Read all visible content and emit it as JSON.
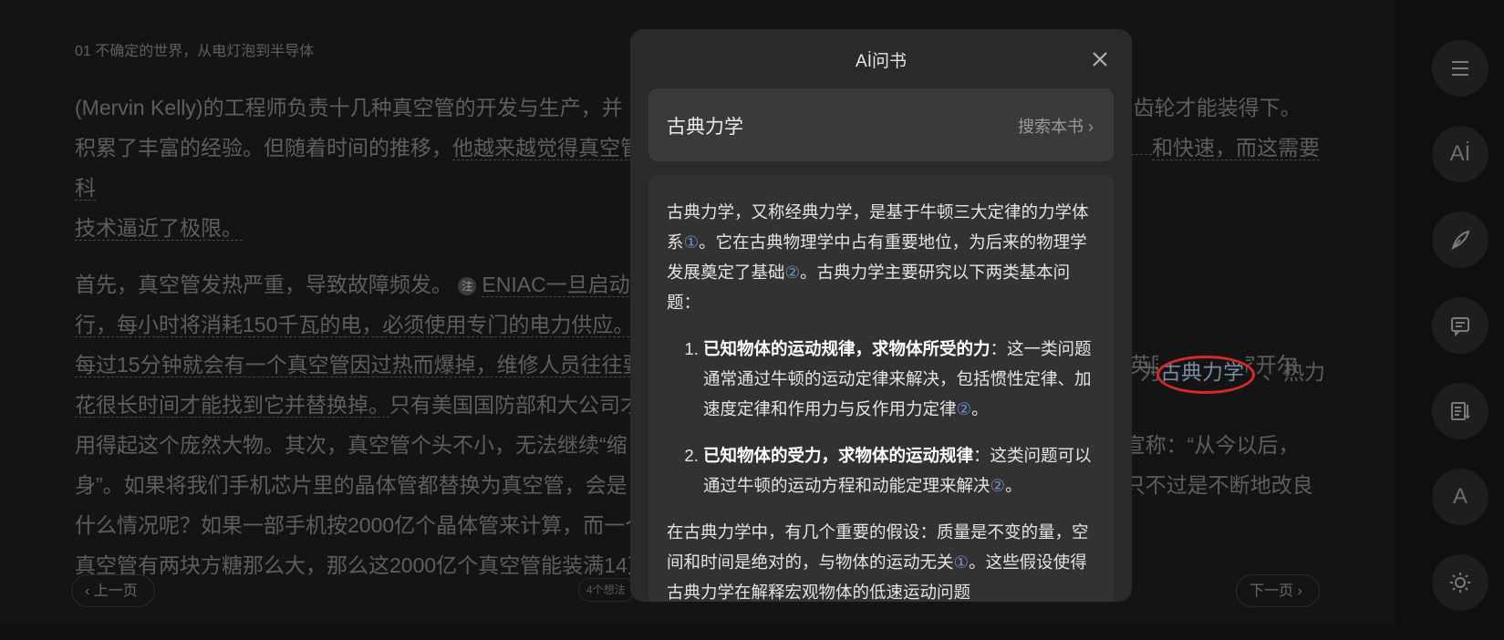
{
  "reader": {
    "chapter_title": "01 不确定的世界，从电灯泡到半导体",
    "para1_a": "(Mervin Kelly)的工程师负责十几种真空管的开发与生产，并",
    "para1_b": "齿轮才能装得下。",
    "para1_c": "积累了丰富的经验。但随着时间的推移，",
    "para1_d": "他越来越觉得真空管",
    "para1_e": "和快速，而这需要科",
    "para1_f": "技术逼近了极限。",
    "para2_a": "首先，真空管发热严重，导致故障频发。",
    "note_icon": "注",
    "para2_b": "ENIAC一旦启动运",
    "para2_c": "行，每小时将消耗150千瓦的电，必须使用专门的电力供应。",
    "para2_d": "每过15分钟就会有一个真空管因过热而爆掉，维修人员往往要",
    "para2_e": "的英国物理学家开尔",
    "para2_f": "花很长时间才能找到它并替换掉。",
    "para2_g": "只有美国国防部和大公司才",
    "para2_h": "用得起这个庞然大物。其次，真空管个头不小，无法继续“缩",
    "para2_i": "宣称：“从今以后，",
    "para2_j": "身”。如果将我们手机芯片里的晶体管都替换为真空管，会是",
    "para2_k": "只不过是不断地改良",
    "para2_l": "什么情况呢？如果一部手机按2000亿个晶体管来计算，而一个",
    "para2_m": "真空管有两块方糖那么大，那么这2000亿个真空管能装满14万",
    "hl_prefix": "为",
    "hl_word": "古典力学",
    "hl_suffix": "、热力",
    "prev_label": "上一页",
    "next_label": "下一页",
    "thoughts": "4个想法"
  },
  "toolbar": {
    "icons": [
      "menu-icon",
      "ai-icon",
      "pen-icon",
      "comment-icon",
      "notes-icon",
      "font-icon",
      "brightness-icon"
    ],
    "ai_label": "Aİ",
    "font_label": "A"
  },
  "modal": {
    "title": "Aİ问书",
    "search_term": "古典力学",
    "search_book": "搜索本书 ›",
    "intro_1": "古典力学，又称经典力学，是基于牛顿三大定律的力学体系",
    "cite1": "①",
    "intro_2": "。它在古典物理学中占有重要地位，为后来的物理学发展奠定了基础",
    "cite2": "②",
    "intro_3": "。古典力学主要研究以下两类基本问题：",
    "item1_bold": "已知物体的运动规律，求物体所受的力",
    "item1_text": "：这一类问题通常通过牛顿的运动定律来解决，包括惯性定律、加速度定律和作用力与反作用力定律",
    "item2_bold": "已知物体的受力，求物体的运动规律",
    "item2_text": "：这类问题可以通过牛顿的运动方程和动能定理来解决",
    "dot": "。",
    "para2_text": "在古典力学中，有几个重要的假设：质量是不变的量，空间和时间是绝对的，与物体的运动无关",
    "para2_tail": "。这些假设使得古典力学在解释宏观物体的低速运动问题"
  }
}
